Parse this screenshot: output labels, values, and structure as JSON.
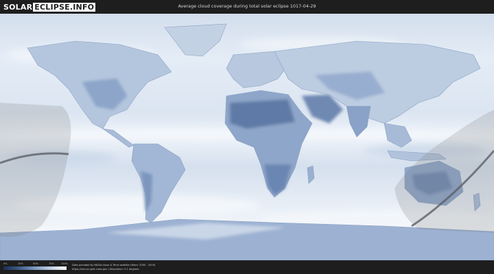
{
  "header": {
    "logo_part1": "SOLAR",
    "logo_part2": "ECLIPSE.INFO",
    "title": "Average cloud coverage during total solar eclipse 1017-04-29"
  },
  "map": {
    "description_type": "world cloud coverage map",
    "eclipse_path": "total eclipse path"
  },
  "legend": {
    "ticks": [
      "0%",
      "25%",
      "50%",
      "75%",
      "100%"
    ],
    "colors": [
      "#1a2f52",
      "#3f5d8a",
      "#7f99bf",
      "#c0cfe3",
      "#ffffff"
    ]
  },
  "footer": {
    "credit_line1": "Data provided by NASAs Aqua & Terra satellite (Years: 2000 - 2019)",
    "credit_line2": "https://neo.sci.gsfc.nasa.gov | Resolution: 0.1 degrees"
  },
  "colors": {
    "background": "#1e1e1e",
    "ocean_cloud": "#e3ebf5",
    "land_clear": "#7e97bd"
  }
}
